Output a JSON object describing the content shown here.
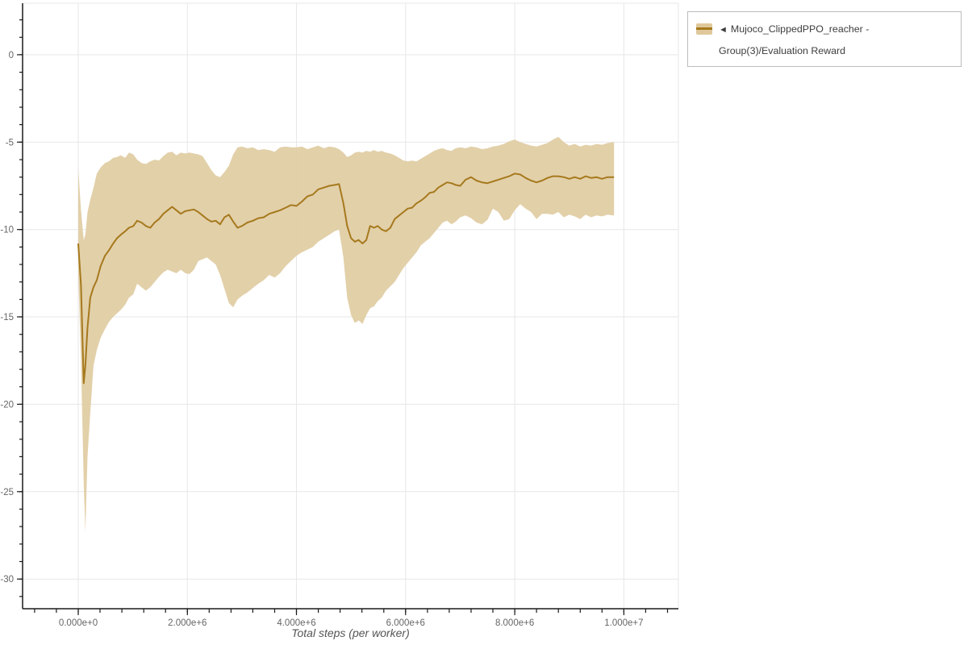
{
  "page": {
    "background": "#ffffff"
  },
  "legend": {
    "arrow": "◄",
    "label": "Mujoco_ClippedPPO_reacher - Group(3)/Evaluation Reward"
  },
  "colors": {
    "band": "#e0cda4",
    "line": "#a6791d",
    "grid": "#e7e7e7",
    "axis": "#1a1a1a",
    "tick_label": "#666666",
    "axis_title": "#555555",
    "legend_border": "#bcbcbc",
    "legend_text": "#3d3d3d"
  },
  "chart_data": {
    "type": "line",
    "xlabel": "Total steps (per worker)",
    "grid": true,
    "legend_position": "top-right",
    "xlim_steps": [
      -1020000,
      11000000
    ],
    "ylim": [
      -31.7,
      2.95
    ],
    "x_axis": {
      "major_tick_values_millions": [
        0,
        2,
        4,
        6,
        8,
        10
      ],
      "major_tick_labels": [
        "0.000e+0",
        "2.000e+6",
        "4.000e+6",
        "6.000e+6",
        "8.000e+6",
        "1.000e+7"
      ],
      "minor_tick_interval_millions": 0.4
    },
    "y_axis": {
      "major_tick_values": [
        0,
        -5,
        -10,
        -15,
        -20,
        -25,
        -30
      ],
      "major_tick_labels": [
        "0",
        "-5",
        "-10",
        "-15",
        "-20",
        "-25",
        "-30"
      ],
      "minor_tick_interval": 1
    },
    "series": [
      {
        "name": "Mujoco_ClippedPPO_reacher - Group(3)/Evaluation Reward",
        "line_color": "#a6791d",
        "band_color": "#e0cda4",
        "x_millions": [
          0.0,
          0.05,
          0.1,
          0.13,
          0.17,
          0.22,
          0.28,
          0.34,
          0.41,
          0.49,
          0.56,
          0.64,
          0.71,
          0.78,
          0.86,
          0.93,
          1.01,
          1.08,
          1.16,
          1.24,
          1.32,
          1.4,
          1.48,
          1.56,
          1.64,
          1.72,
          1.8,
          1.88,
          1.96,
          2.04,
          2.12,
          2.2,
          2.28,
          2.36,
          2.44,
          2.52,
          2.6,
          2.68,
          2.76,
          2.84,
          2.92,
          3.0,
          3.1,
          3.2,
          3.3,
          3.4,
          3.5,
          3.6,
          3.7,
          3.8,
          3.9,
          4.0,
          4.1,
          4.2,
          4.3,
          4.4,
          4.5,
          4.6,
          4.7,
          4.78,
          4.86,
          4.93,
          5.0,
          5.07,
          5.14,
          5.21,
          5.28,
          5.35,
          5.42,
          5.49,
          5.56,
          5.64,
          5.72,
          5.8,
          5.88,
          5.96,
          6.04,
          6.12,
          6.2,
          6.28,
          6.36,
          6.44,
          6.52,
          6.6,
          6.68,
          6.76,
          6.84,
          6.92,
          7.0,
          7.1,
          7.2,
          7.3,
          7.4,
          7.5,
          7.6,
          7.7,
          7.8,
          7.9,
          8.0,
          8.1,
          8.2,
          8.3,
          8.4,
          8.5,
          8.6,
          8.7,
          8.8,
          8.9,
          9.0,
          9.1,
          9.2,
          9.3,
          9.4,
          9.5,
          9.6,
          9.7,
          9.82
        ],
        "mean": [
          -10.8,
          -13.2,
          -18.8,
          -17.8,
          -15.6,
          -13.9,
          -13.3,
          -12.9,
          -12.1,
          -11.5,
          -11.2,
          -10.8,
          -10.5,
          -10.3,
          -10.1,
          -9.9,
          -9.8,
          -9.5,
          -9.6,
          -9.8,
          -9.9,
          -9.6,
          -9.4,
          -9.1,
          -8.9,
          -8.7,
          -8.9,
          -9.1,
          -8.95,
          -8.9,
          -8.85,
          -9.0,
          -9.2,
          -9.4,
          -9.55,
          -9.5,
          -9.7,
          -9.3,
          -9.15,
          -9.55,
          -9.9,
          -9.8,
          -9.6,
          -9.5,
          -9.35,
          -9.3,
          -9.1,
          -9.0,
          -8.9,
          -8.75,
          -8.6,
          -8.65,
          -8.4,
          -8.1,
          -8.0,
          -7.7,
          -7.6,
          -7.5,
          -7.45,
          -7.4,
          -8.5,
          -9.8,
          -10.5,
          -10.7,
          -10.6,
          -10.8,
          -10.6,
          -9.8,
          -9.9,
          -9.8,
          -10.0,
          -10.1,
          -9.9,
          -9.4,
          -9.2,
          -9.0,
          -8.8,
          -8.75,
          -8.5,
          -8.35,
          -8.15,
          -7.9,
          -7.85,
          -7.6,
          -7.45,
          -7.3,
          -7.35,
          -7.45,
          -7.5,
          -7.15,
          -7.0,
          -7.2,
          -7.3,
          -7.35,
          -7.25,
          -7.15,
          -7.05,
          -6.95,
          -6.8,
          -6.85,
          -7.05,
          -7.2,
          -7.3,
          -7.2,
          -7.05,
          -6.95,
          -6.95,
          -7.0,
          -7.1,
          -7.0,
          -7.1,
          -6.95,
          -7.05,
          -7.0,
          -7.1,
          -7.0,
          -7.0
        ],
        "band_hi": [
          -6.5,
          -8.9,
          -10.6,
          -10.3,
          -9.0,
          -8.3,
          -7.6,
          -6.8,
          -6.45,
          -6.2,
          -6.1,
          -5.9,
          -5.85,
          -5.75,
          -5.9,
          -5.6,
          -5.7,
          -6.0,
          -6.2,
          -6.25,
          -6.1,
          -6.0,
          -6.05,
          -5.8,
          -5.6,
          -5.55,
          -5.75,
          -5.6,
          -5.65,
          -5.6,
          -5.65,
          -5.7,
          -5.8,
          -6.2,
          -6.6,
          -6.9,
          -7.0,
          -6.7,
          -6.35,
          -5.7,
          -5.3,
          -5.25,
          -5.35,
          -5.3,
          -5.45,
          -5.4,
          -5.45,
          -5.55,
          -5.3,
          -5.25,
          -5.3,
          -5.3,
          -5.25,
          -5.4,
          -5.3,
          -5.2,
          -5.35,
          -5.25,
          -5.3,
          -5.4,
          -5.6,
          -5.85,
          -5.75,
          -5.6,
          -5.55,
          -5.6,
          -5.5,
          -5.55,
          -5.45,
          -5.55,
          -5.5,
          -5.6,
          -5.65,
          -5.75,
          -5.9,
          -6.05,
          -6.1,
          -6.05,
          -6.1,
          -5.95,
          -5.8,
          -5.65,
          -5.5,
          -5.4,
          -5.35,
          -5.45,
          -5.5,
          -5.35,
          -5.3,
          -5.35,
          -5.25,
          -5.3,
          -5.4,
          -5.35,
          -5.25,
          -5.2,
          -5.1,
          -4.95,
          -4.85,
          -5.0,
          -5.1,
          -5.2,
          -5.25,
          -5.15,
          -5.05,
          -4.85,
          -4.7,
          -5.0,
          -5.2,
          -5.1,
          -5.25,
          -5.15,
          -5.2,
          -5.1,
          -5.15,
          -5.05,
          -5.0
        ],
        "band_lo": [
          -12.6,
          -17.5,
          -24.5,
          -27.3,
          -23.0,
          -20.5,
          -17.8,
          -16.9,
          -16.2,
          -15.7,
          -15.3,
          -15.0,
          -14.8,
          -14.6,
          -14.3,
          -13.9,
          -13.7,
          -13.1,
          -13.3,
          -13.5,
          -13.3,
          -13.0,
          -12.7,
          -12.45,
          -12.3,
          -12.4,
          -12.5,
          -12.3,
          -12.5,
          -12.55,
          -12.3,
          -11.8,
          -11.7,
          -11.6,
          -11.8,
          -12.0,
          -12.6,
          -13.4,
          -14.2,
          -14.45,
          -14.0,
          -13.8,
          -13.6,
          -13.35,
          -13.1,
          -12.9,
          -12.6,
          -12.75,
          -12.5,
          -12.1,
          -11.8,
          -11.5,
          -11.3,
          -11.15,
          -11.0,
          -10.7,
          -10.5,
          -10.3,
          -10.1,
          -10.0,
          -11.6,
          -13.9,
          -14.9,
          -15.35,
          -15.2,
          -15.4,
          -14.9,
          -14.5,
          -14.4,
          -14.1,
          -13.9,
          -13.5,
          -13.25,
          -13.0,
          -12.6,
          -12.2,
          -11.9,
          -11.6,
          -11.3,
          -10.9,
          -10.7,
          -10.5,
          -10.2,
          -9.9,
          -9.6,
          -9.5,
          -9.7,
          -9.55,
          -9.3,
          -9.2,
          -9.35,
          -9.6,
          -9.7,
          -9.45,
          -8.8,
          -9.0,
          -9.5,
          -9.4,
          -8.9,
          -8.55,
          -8.8,
          -9.0,
          -9.4,
          -9.1,
          -9.1,
          -9.15,
          -9.0,
          -9.3,
          -9.15,
          -9.25,
          -9.4,
          -9.15,
          -9.3,
          -9.2,
          -9.25,
          -9.15,
          -9.2
        ]
      }
    ]
  }
}
